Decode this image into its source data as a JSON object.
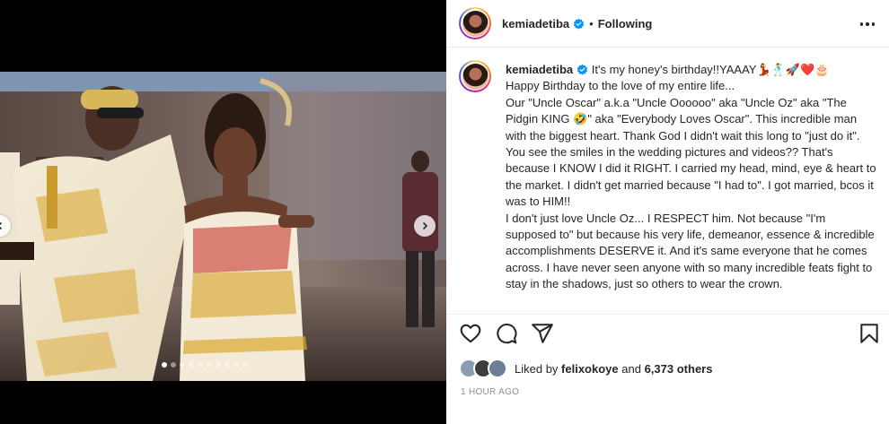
{
  "post": {
    "username": "kemiadetiba",
    "follow_state": "Following",
    "separator": "•",
    "caption_lines": [
      "It's my honey's birthday!!YAAAY💃🕺🚀❤️🎂",
      "Happy Birthday to the love of my entire life...",
      "Our \"Uncle Oscar\" a.k.a \"Uncle Oooooo\" aka \"Uncle Oz\" aka \"The Pidgin KING 🤣\" aka \"Everybody Loves Oscar\". This incredible man with the biggest heart. Thank God I didn't wait this long to \"just do it\". You see the smiles in the wedding pictures and videos?? That's because I KNOW I did it RIGHT. I carried my head, mind, eye & heart to the market. I didn't get married because \"I had to\". I got married, bcos it was to HIM!!",
      "I don't just love Uncle Oz... I RESPECT him. Not because \"I'm supposed to\" but because his very life, demeanor, essence & incredible accomplishments DESERVE it. And it's same everyone that he comes across. I have never seen anyone with so many incredible feats fight to stay in the shadows, just so others to wear the crown."
    ],
    "likes_prefix": "Liked by",
    "liked_by_user": "felixokoye",
    "likes_connector": "and",
    "likes_count": "6,373 others",
    "timestamp": "1 HOUR AGO"
  },
  "media": {
    "carousel_count": 10,
    "carousel_active": 0
  },
  "icons": {
    "verified": "verified-badge-icon",
    "more": "more-options-icon",
    "like": "heart-icon",
    "comment": "comment-icon",
    "share": "share-icon",
    "save": "bookmark-icon",
    "next": "chevron-right-icon",
    "prev": "chevron-left-icon"
  },
  "colors": {
    "verified_blue": "#0095f6",
    "text": "#262626",
    "muted": "#8e8e8e",
    "border": "#efefef"
  }
}
